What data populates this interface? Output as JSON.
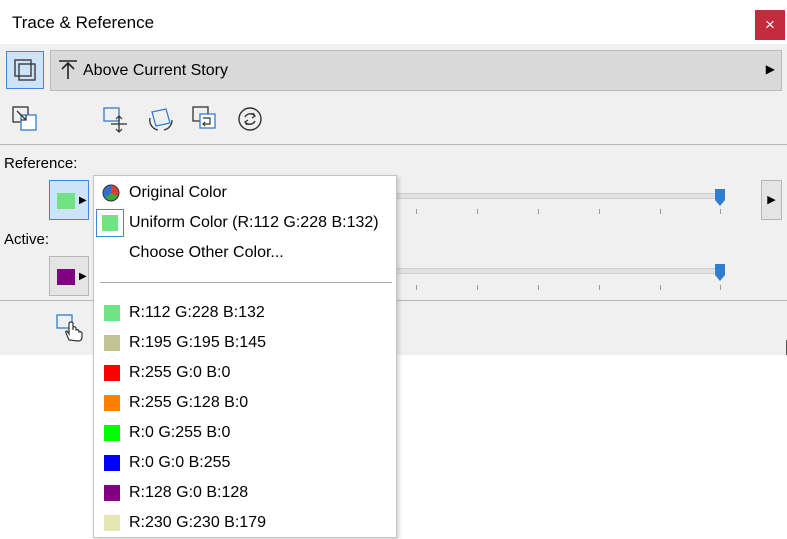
{
  "window": {
    "title": "Trace & Reference",
    "close_label": "×"
  },
  "story": {
    "label": "Above Current Story",
    "arrow": "▶"
  },
  "toolbar_icons": [
    "fit-reference-icon",
    "move-reference-icon",
    "rotate-reference-icon",
    "swap-reference-icon",
    "reset-reference-icon"
  ],
  "reference": {
    "label": "Reference:",
    "color": "#70e484"
  },
  "active": {
    "label": "Active:",
    "color": "#800080"
  },
  "accent": "#2f7fd0",
  "side_arrow": "▶",
  "dropdown_arrow": "▶",
  "color_menu": {
    "original_label": "Original Color",
    "uniform_label": "Uniform Color (R:112 G:228 B:132)",
    "uniform_color": "#70e484",
    "choose_label": "Choose Other Color...",
    "recent": [
      {
        "label": "R:112 G:228 B:132",
        "color": "#70e484"
      },
      {
        "label": "R:195 G:195 B:145",
        "color": "#c3c391"
      },
      {
        "label": "R:255 G:0 B:0",
        "color": "#ff0000"
      },
      {
        "label": "R:255 G:128 B:0",
        "color": "#ff8000"
      },
      {
        "label": "R:0 G:255 B:0",
        "color": "#00ff00"
      },
      {
        "label": "R:0 G:0 B:255",
        "color": "#0000ff"
      },
      {
        "label": "R:128 G:0 B:128",
        "color": "#800080"
      },
      {
        "label": "R:230 G:230 B:179",
        "color": "#e6e6b3"
      }
    ]
  }
}
